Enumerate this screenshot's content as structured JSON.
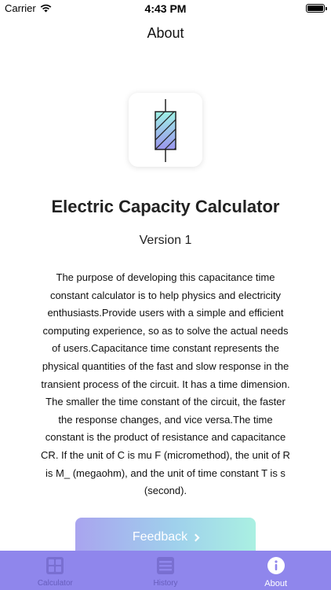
{
  "status_bar": {
    "carrier": "Carrier",
    "time": "4:43 PM"
  },
  "nav": {
    "title": "About"
  },
  "app": {
    "name": "Electric Capacity Calculator",
    "version": "Version 1",
    "description": "The purpose of developing this capacitance time constant calculator is to help physics and electricity enthusiasts.Provide users with a simple and efficient computing experience, so as to solve the actual needs of users.Capacitance time constant represents the physical quantities of the fast and slow response in the transient process of the circuit. It has a time dimension. The smaller the time constant of the circuit, the faster the response changes, and vice versa.The time constant is the product of resistance and capacitance CR. If the unit of C is mu F (micromethod), the unit of R is M_ (megaohm), and the unit of time constant T is s (second).",
    "icon": "resistor-icon"
  },
  "feedback": {
    "label": "Feedback"
  },
  "tabs": [
    {
      "label": "Calculator",
      "icon": "grid-icon",
      "active": false
    },
    {
      "label": "History",
      "icon": "list-icon",
      "active": false
    },
    {
      "label": "About",
      "icon": "info-icon",
      "active": true
    }
  ],
  "colors": {
    "tab_bar": "#8f86ec",
    "accent_start": "#a9a4ef",
    "accent_end": "#aaf0e2"
  }
}
